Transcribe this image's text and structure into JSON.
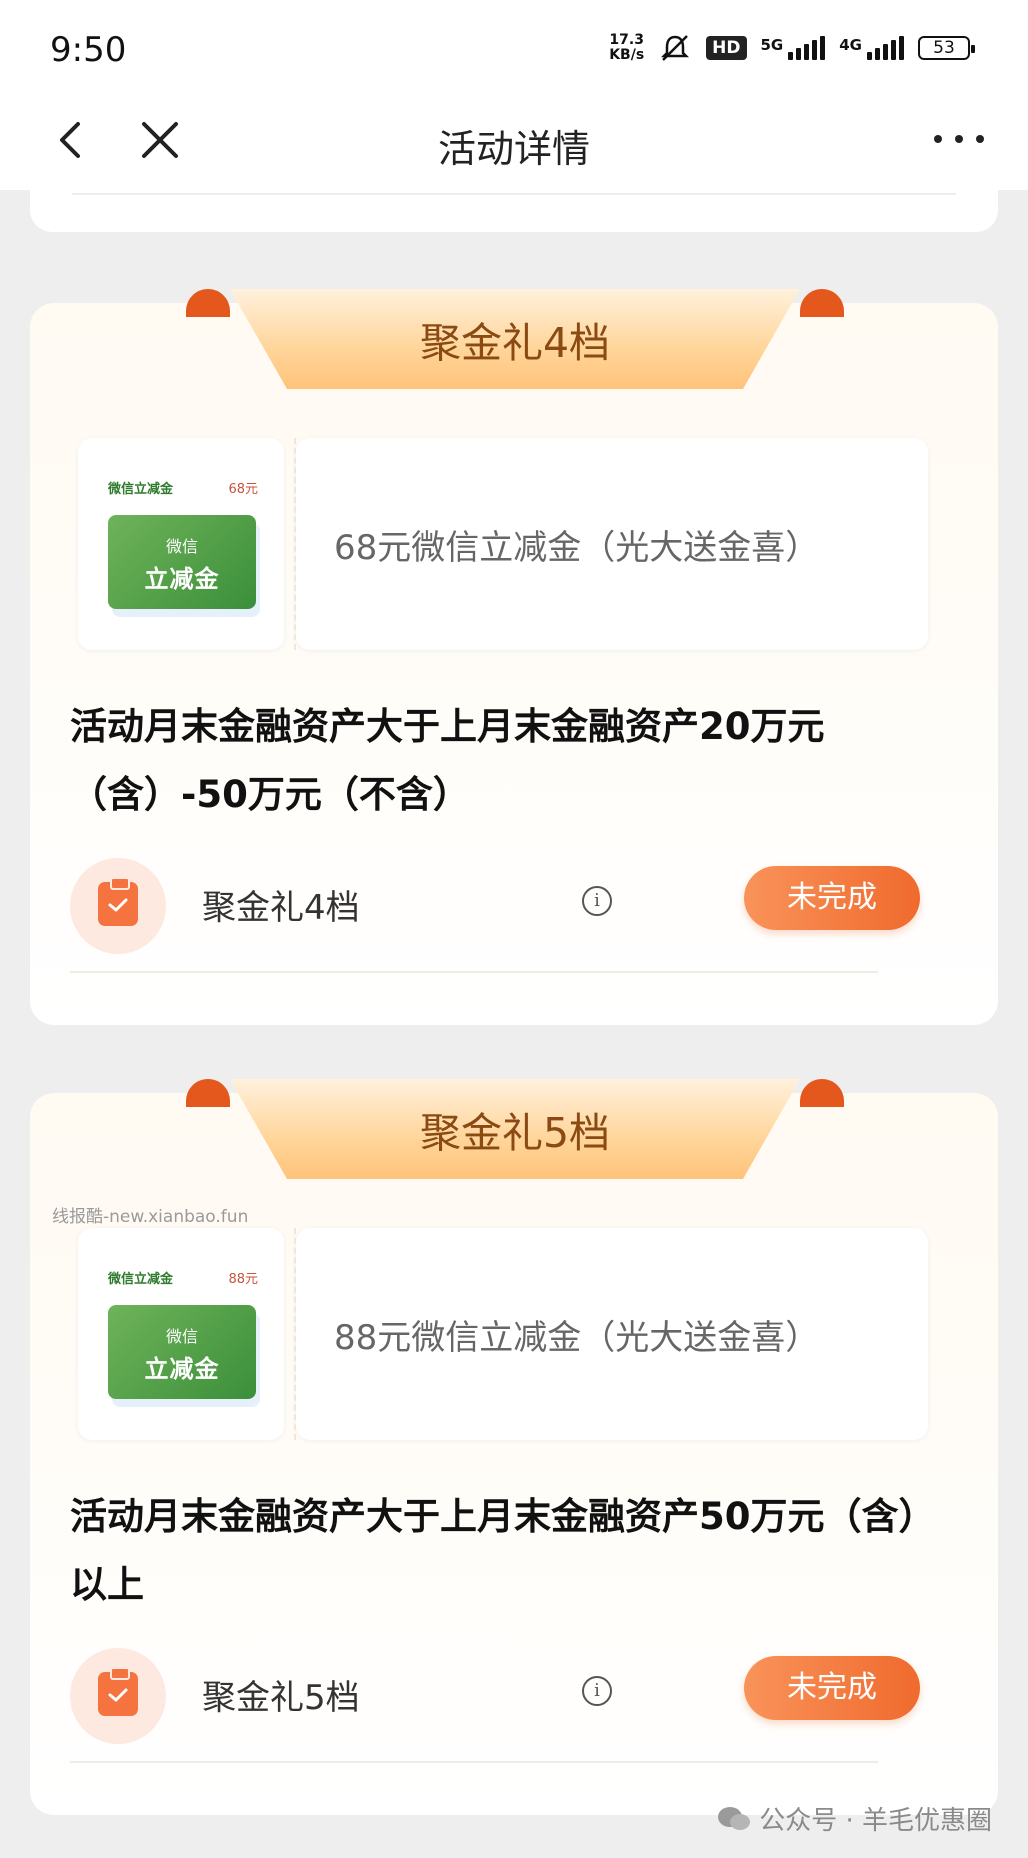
{
  "status_bar": {
    "time": "9:50",
    "net_speed": "17.3",
    "net_speed_unit": "KB/s",
    "hd_label": "HD",
    "net_5g": "5G",
    "net_4g": "4G",
    "battery": "53"
  },
  "nav": {
    "title": "活动详情",
    "back_icon": "chevron-left-icon",
    "close_icon": "close-icon",
    "more_icon": "more-dots-icon"
  },
  "tiers": [
    {
      "tab_label": "聚金礼4档",
      "reward_tag": "微信立减金",
      "reward_value": "68元",
      "reward_card_line1": "微信",
      "reward_card_line2": "立减金",
      "reward_desc": "68元微信立减金（光大送金喜）",
      "condition": "活动月末金融资产大于上月末金融资产20万元（含）-50万元（不含）",
      "task_label": "聚金礼4档",
      "status": "未完成"
    },
    {
      "tab_label": "聚金礼5档",
      "reward_tag": "微信立减金",
      "reward_value": "88元",
      "reward_card_line1": "微信",
      "reward_card_line2": "立减金",
      "reward_desc": "88元微信立减金（光大送金喜）",
      "condition": "活动月末金融资产大于上月末金融资产50万元（含）以上",
      "task_label": "聚金礼5档",
      "status": "未完成"
    }
  ],
  "watermarks": {
    "left": "线报酷-new.xianbao.fun",
    "right": "公众号 · 羊毛优惠圈"
  },
  "colors": {
    "accent": "#f06a2d",
    "tab_text": "#8a4a12",
    "wechat_green": "#3b8f3a"
  }
}
